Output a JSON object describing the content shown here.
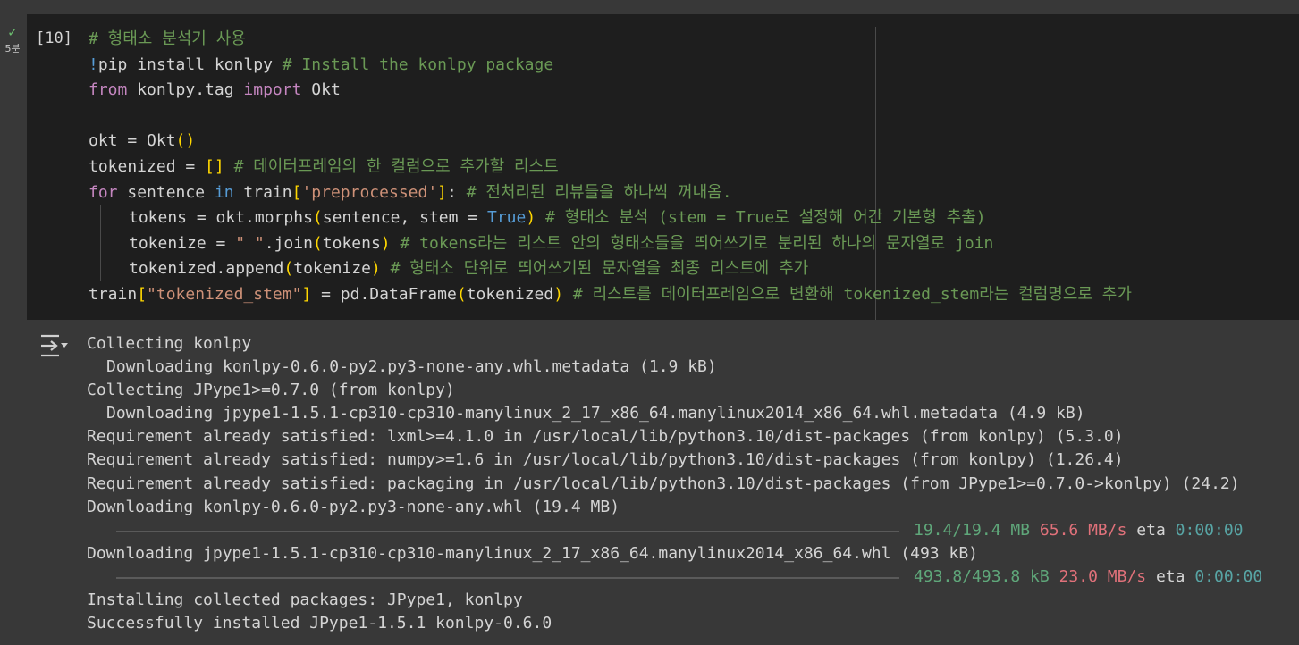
{
  "cell": {
    "status_icon": "check-icon",
    "status_color": "#6cc070",
    "runtime": "5분",
    "exec_count": "[10]",
    "code": {
      "l1": "# 형태소 분석기 사용",
      "l2_bang": "!",
      "l2_cmd": "pip install konlpy ",
      "l2_comment": "# Install the konlpy package",
      "l3_from": "from",
      "l3_mod": " konlpy.tag ",
      "l3_import": "import",
      "l3_name": " Okt",
      "l5_pre": "okt = Okt",
      "l5_paren": "()",
      "l6_pre": "tokenized = ",
      "l6_br": "[]",
      "l6_comment": " # 데이터프레임의 한 컬럼으로 추가할 리스트",
      "l7_for": "for",
      "l7_mid": " sentence ",
      "l7_in": "in",
      "l7_mid2": " train",
      "l7_lb": "[",
      "l7_str": "'preprocessed'",
      "l7_rb": "]",
      "l7_colon": ":",
      "l7_comment": " # 전처리된 리뷰들을 하나씩 꺼내옴.",
      "l8_pre": "tokens = okt.morphs",
      "l8_lp": "(",
      "l8_mid": "sentence, stem = ",
      "l8_true": "True",
      "l8_rp": ")",
      "l8_comment": " # 형태소 분석 (stem = True로 설정해 어간 기본형 추출)",
      "l9_pre": "tokenize = ",
      "l9_str": "\" \"",
      "l9_mid": ".join",
      "l9_lp": "(",
      "l9_arg": "tokens",
      "l9_rp": ")",
      "l9_comment": " # tokens라는 리스트 안의 형태소들을 띄어쓰기로 분리된 하나의 문자열로 join",
      "l10_pre": "tokenized.append",
      "l10_lp": "(",
      "l10_arg": "tokenize",
      "l10_rp": ")",
      "l10_comment": " # 형태소 단위로 띄어쓰기된 문자열을 최종 리스트에 추가",
      "l11_pre": "train",
      "l11_lb": "[",
      "l11_str": "\"tokenized_stem\"",
      "l11_rb": "]",
      "l11_mid": " = pd.DataFrame",
      "l11_lp": "(",
      "l11_arg": "tokenized",
      "l11_rp": ")",
      "l11_comment": " # 리스트를 데이터프레임으로 변환해 tokenized_stem라는 컬럼명으로 추가"
    }
  },
  "output": {
    "icon": "output-toggle-icon",
    "l1": "Collecting konlpy",
    "l2": "Downloading konlpy-0.6.0-py2.py3-none-any.whl.metadata (1.9 kB)",
    "l3": "Collecting JPype1>=0.7.0 (from konlpy)",
    "l4": "Downloading jpype1-1.5.1-cp310-cp310-manylinux_2_17_x86_64.manylinux2014_x86_64.whl.metadata (4.9 kB)",
    "l5": "Requirement already satisfied: lxml>=4.1.0 in /usr/local/lib/python3.10/dist-packages (from konlpy) (5.3.0)",
    "l6": "Requirement already satisfied: numpy>=1.6 in /usr/local/lib/python3.10/dist-packages (from konlpy) (1.26.4)",
    "l7": "Requirement already satisfied: packaging in /usr/local/lib/python3.10/dist-packages (from JPype1>=0.7.0->konlpy) (24.2)",
    "l8": "Downloading konlpy-0.6.0-py2.py3-none-any.whl (19.4 MB)",
    "bar1": {
      "progress": 1.0,
      "size": "19.4/19.4 MB",
      "speed": "65.6 MB/s",
      "eta_label": "eta",
      "eta": "0:00:00"
    },
    "l10": "Downloading jpype1-1.5.1-cp310-cp310-manylinux_2_17_x86_64.manylinux2014_x86_64.whl (493 kB)",
    "bar2": {
      "progress": 1.0,
      "size": "493.8/493.8 kB",
      "speed": "23.0 MB/s",
      "eta_label": "eta",
      "eta": "0:00:00"
    },
    "l12": "Installing collected packages: JPype1, konlpy",
    "l13": "Successfully installed JPype1-1.5.1 konlpy-0.6.0"
  }
}
